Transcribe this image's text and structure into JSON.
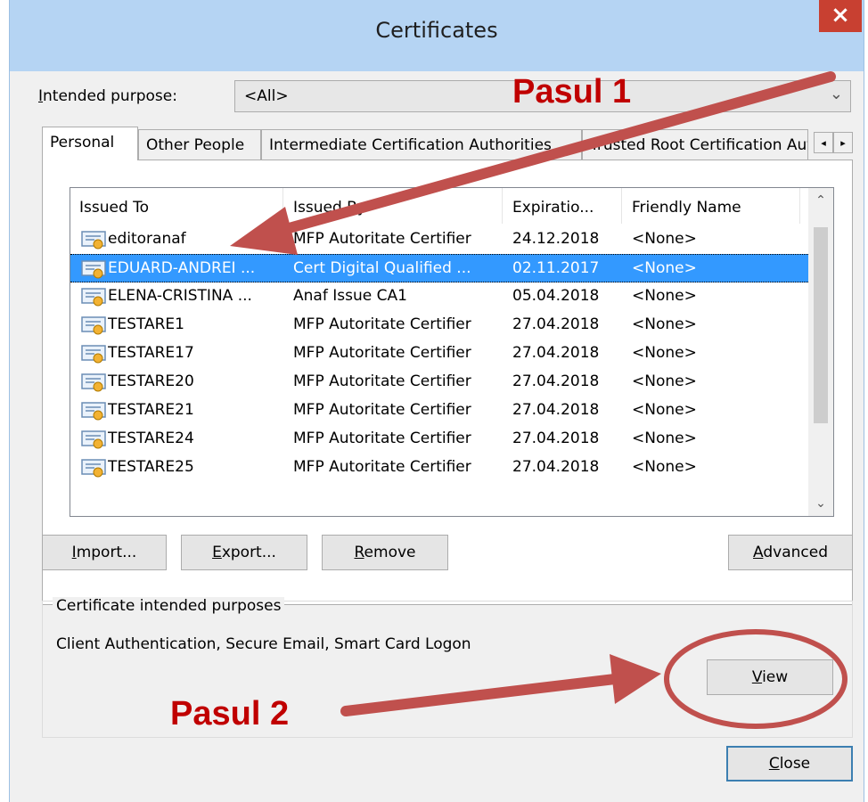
{
  "window": {
    "title": "Certificates",
    "close_glyph": "×"
  },
  "intended_purpose": {
    "label_prefix": "I",
    "label_rest": "ntended purpose:",
    "value": "<All>"
  },
  "tabs": [
    {
      "label": "Personal",
      "active": true
    },
    {
      "label": "Other People",
      "active": false
    },
    {
      "label": "Intermediate Certification Authorities",
      "active": false
    },
    {
      "label": "Trusted Root Certification Authorities",
      "active": false
    }
  ],
  "tab_scroll": {
    "left": "◂",
    "right": "▸"
  },
  "list": {
    "columns": [
      "Issued To",
      "Issued By",
      "Expiratio...",
      "Friendly Name"
    ],
    "rows": [
      {
        "issued_to": "editoranaf",
        "issued_by": "MFP Autoritate Certifier",
        "expiration": "24.12.2018",
        "friendly": "<None>",
        "selected": false
      },
      {
        "issued_to": "EDUARD-ANDREI ...",
        "issued_by": "Cert Digital Qualified ...",
        "expiration": "02.11.2017",
        "friendly": "<None>",
        "selected": true
      },
      {
        "issued_to": "ELENA-CRISTINA ...",
        "issued_by": "Anaf Issue CA1",
        "expiration": "05.04.2018",
        "friendly": "<None>",
        "selected": false
      },
      {
        "issued_to": "TESTARE1",
        "issued_by": "MFP Autoritate Certifier",
        "expiration": "27.04.2018",
        "friendly": "<None>",
        "selected": false
      },
      {
        "issued_to": "TESTARE17",
        "issued_by": "MFP Autoritate Certifier",
        "expiration": "27.04.2018",
        "friendly": "<None>",
        "selected": false
      },
      {
        "issued_to": "TESTARE20",
        "issued_by": "MFP Autoritate Certifier",
        "expiration": "27.04.2018",
        "friendly": "<None>",
        "selected": false
      },
      {
        "issued_to": "TESTARE21",
        "issued_by": "MFP Autoritate Certifier",
        "expiration": "27.04.2018",
        "friendly": "<None>",
        "selected": false
      },
      {
        "issued_to": "TESTARE24",
        "issued_by": "MFP Autoritate Certifier",
        "expiration": "27.04.2018",
        "friendly": "<None>",
        "selected": false
      },
      {
        "issued_to": "TESTARE25",
        "issued_by": "MFP Autoritate Certifier",
        "expiration": "27.04.2018",
        "friendly": "<None>",
        "selected": false
      }
    ],
    "row_icon": "certificate-icon"
  },
  "buttons": {
    "import": {
      "u": "I",
      "rest": "mport..."
    },
    "export": {
      "u": "E",
      "rest": "xport..."
    },
    "remove": {
      "u": "R",
      "rest": "emove"
    },
    "advanced": {
      "u": "A",
      "rest": "dvanced"
    },
    "view": {
      "u": "V",
      "rest": "iew"
    },
    "close": {
      "u": "C",
      "rest": "lose"
    }
  },
  "purposes": {
    "group_label": "Certificate intended purposes",
    "text": "Client Authentication, Secure Email, Smart Card Logon"
  },
  "annotations": {
    "step1": "Pasul 1",
    "step2": "Pasul 2",
    "color": "#c0392b"
  }
}
